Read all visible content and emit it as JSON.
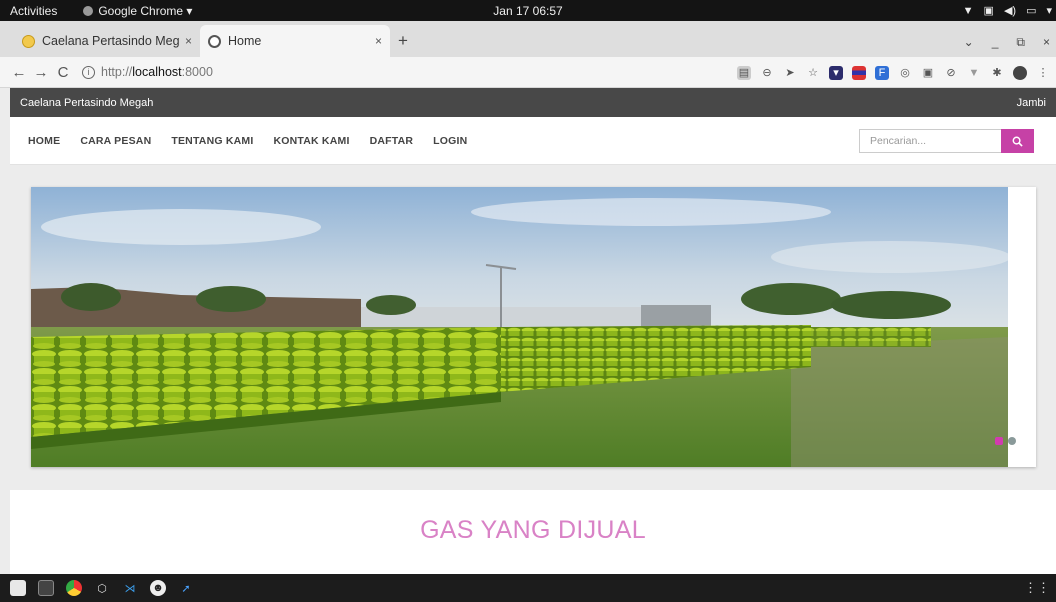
{
  "topbar": {
    "activities": "Activities",
    "app": "Google Chrome ▾",
    "clock": "Jan 17  06:57",
    "tray": [
      "▼",
      "▣",
      "◀)",
      "▭",
      "▾"
    ]
  },
  "tabs": [
    {
      "label": "Caelana Pertasindo Mega",
      "close": "×"
    },
    {
      "label": "Home",
      "close": "×"
    }
  ],
  "tabstrip": {
    "new_tab": "+",
    "window_controls": [
      "⌄",
      "_",
      "⧉",
      "×"
    ]
  },
  "omnibox": {
    "back": "←",
    "forward": "→",
    "reload": "C",
    "info": "i",
    "url_scheme": "http://",
    "url_host": "localhost",
    "url_rest": ":8000",
    "extension_icons": [
      "translate-icon",
      "zoom-icon",
      "send-icon",
      "star-icon",
      "pocket-icon",
      "stack-icon",
      "f-icon",
      "circle-icon",
      "card-icon",
      "shield-icon",
      "vuejs-icon",
      "puzzle-icon",
      "avatar-icon",
      "kebab-menu-icon"
    ]
  },
  "site": {
    "brand": "Caelana Pertasindo Megah",
    "city": "Jambi",
    "menu": [
      "HOME",
      "CARA PESAN",
      "TENTANG KAMI",
      "KONTAK KAMI",
      "DAFTAR",
      "LOGIN"
    ],
    "search_placeholder": "Pencarian...",
    "search_icon": "search-icon",
    "accent": "#c641a6",
    "slider_dots": 2,
    "active_dot": 0,
    "section_title": "GAS YANG DIJUAL",
    "section_title_color": "#d982c6"
  },
  "taskbar": {
    "apps": [
      "files-icon",
      "terminal-icon",
      "chrome-icon",
      "virtualbox-icon",
      "vscode-icon",
      "discord-icon",
      "postman-icon"
    ],
    "grid": "⋮⋮"
  }
}
